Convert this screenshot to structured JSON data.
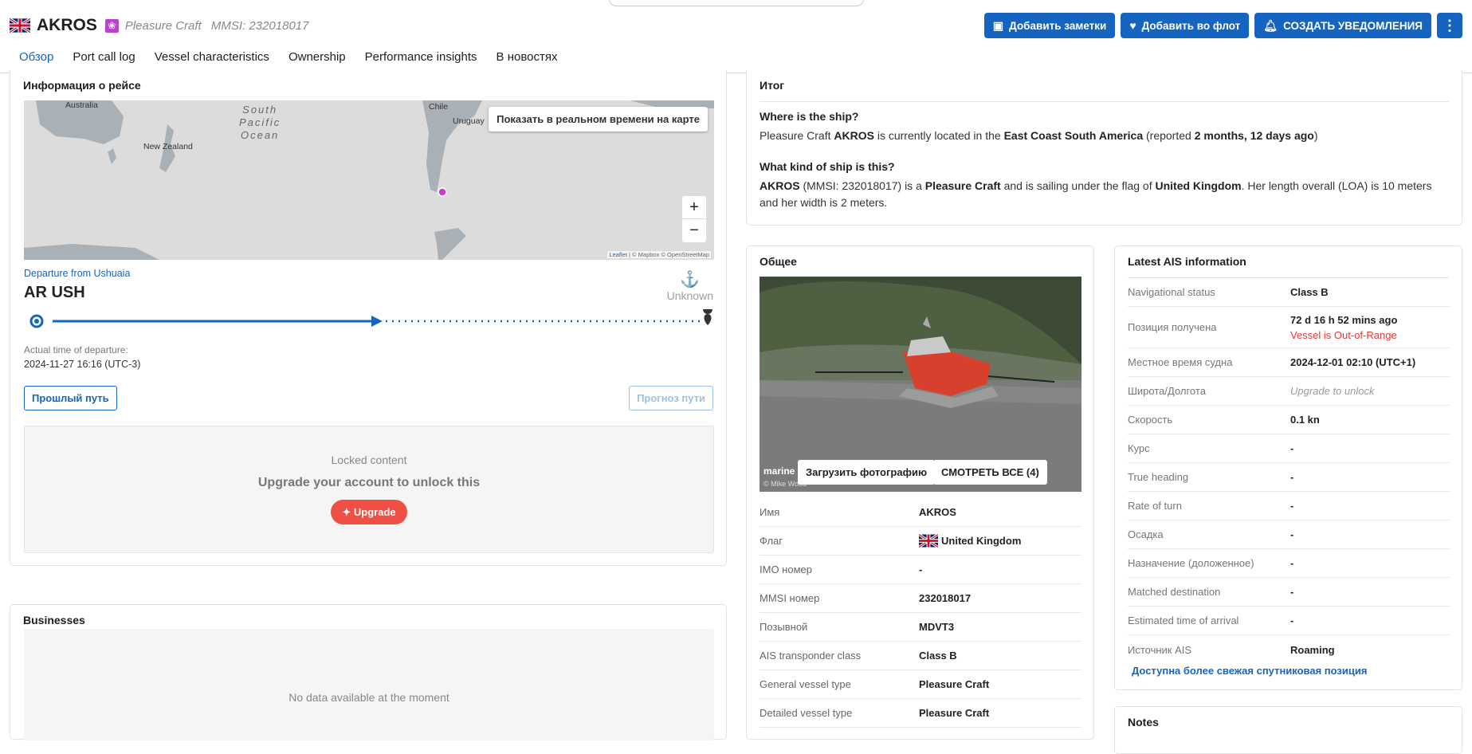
{
  "header": {
    "vessel_name": "AKROS",
    "vessel_type": "Pleasure Craft",
    "mmsi_label": "MMSI: 232018017",
    "actions": {
      "add_notes": "Добавить заметки",
      "add_fleet": "Добавить во флот",
      "create_alerts": "СОЗДАТЬ УВЕДОМЛЕНИЯ",
      "more": "⋮"
    }
  },
  "tabs": [
    "Обзор",
    "Port call log",
    "Vessel characteristics",
    "Ownership",
    "Performance insights",
    "В новостях"
  ],
  "voyage": {
    "title": "Информация о рейсе",
    "map_button": "Показать в реальном времени на карте",
    "zoom_in": "+",
    "zoom_out": "−",
    "attribution_leaflet": "Leaflet",
    "attribution_rest": " | © Mapbox © OpenStreetMap",
    "map_labels": {
      "australia": "Australia",
      "new_zealand": "New Zealand",
      "chile": "Chile",
      "uruguay": "Uruguay",
      "ocean_1": "South",
      "ocean_2": "Pacific",
      "ocean_3": "Ocean"
    },
    "departure_label": "Departure from Ushuaia",
    "departure_code": "AR USH",
    "destination": "Unknown",
    "atd_label": "Actual time of departure:",
    "atd_value": "2024-11-27 16:16 (UTC-3)",
    "past_track": "Прошлый путь",
    "forecast_track": "Прогноз пути",
    "locked_label": "Locked content",
    "locked_text": "Upgrade your account to unlock this",
    "upgrade_button": "Upgrade"
  },
  "businesses": {
    "title": "Businesses",
    "empty": "No data available at the moment"
  },
  "summary": {
    "title": "Итог",
    "q1": "Where is the ship?",
    "a1_p1": "Pleasure Craft ",
    "a1_name": "AKROS",
    "a1_p2": " is currently located in the ",
    "a1_area": "East Coast South America",
    "a1_p3": " (reported ",
    "a1_time": "2 months, 12 days ago",
    "a1_p4": ")",
    "q2": "What kind of ship is this?",
    "a2_name": "AKROS",
    "a2_p1": " (MMSI: 232018017) is a ",
    "a2_type": "Pleasure Craft",
    "a2_p2": " and is sailing under the flag of ",
    "a2_flag": "United Kingdom",
    "a2_p3": ". Her length overall (LOA) is 10 meters and her width is 2 meters."
  },
  "general": {
    "title": "Общее",
    "photo_mark": "marine",
    "photo_credit": "© Mike Wood",
    "upload_photo": "Загрузить фотографию",
    "view_all": "СМОТРЕТЬ ВСЕ (4)",
    "rows": [
      {
        "k": "Имя",
        "v": "AKROS"
      },
      {
        "k": "Флаг",
        "v": "United Kingdom"
      },
      {
        "k": "IMO номер",
        "v": "-"
      },
      {
        "k": "MMSI номер",
        "v": "232018017"
      },
      {
        "k": "Позывной",
        "v": "MDVT3"
      },
      {
        "k": "AIS transponder class",
        "v": "Class B"
      },
      {
        "k": "General vessel type",
        "v": "Pleasure Craft"
      },
      {
        "k": "Detailed vessel type",
        "v": "Pleasure Craft"
      }
    ]
  },
  "ais": {
    "title": "Latest AIS information",
    "rows": [
      {
        "k": "Navigational status",
        "v": "Class B"
      },
      {
        "k": "Позиция получена",
        "v": "72 d 16 h 52 mins ago",
        "v2": "Vessel is Out-of-Range"
      },
      {
        "k": "Местное время судна",
        "v": "2024-12-01 02:10 (UTC+1)"
      },
      {
        "k": "Широта/Долгота",
        "v": "Upgrade to unlock"
      },
      {
        "k": "Скорость",
        "v": "0.1 kn"
      },
      {
        "k": "Курс",
        "v": "-"
      },
      {
        "k": "True heading",
        "v": "-"
      },
      {
        "k": "Rate of turn",
        "v": "-"
      },
      {
        "k": "Осадка",
        "v": "-"
      },
      {
        "k": "Назначение (доложенное)",
        "v": "-"
      },
      {
        "k": "Matched destination",
        "v": "-"
      },
      {
        "k": "Estimated time of arrival",
        "v": "-"
      },
      {
        "k": "Источник AIS",
        "v": "Roaming"
      }
    ],
    "satellite_link": "Доступна более свежая спутниковая позиция"
  },
  "notes": {
    "title": "Notes"
  },
  "colors": {
    "accent": "#1565c0",
    "upgrade": "#f04f43",
    "vessel_marker": "#c83cd2",
    "type_badge": "#b644c8",
    "out_of_range": "#e53935"
  },
  "icons": [
    "uk-flag-icon",
    "pleasure-craft-icon",
    "note-add-icon",
    "heart-icon",
    "bell-icon",
    "more-vertical-icon",
    "anchor-icon",
    "port-pin-icon",
    "sparkle-icon"
  ]
}
